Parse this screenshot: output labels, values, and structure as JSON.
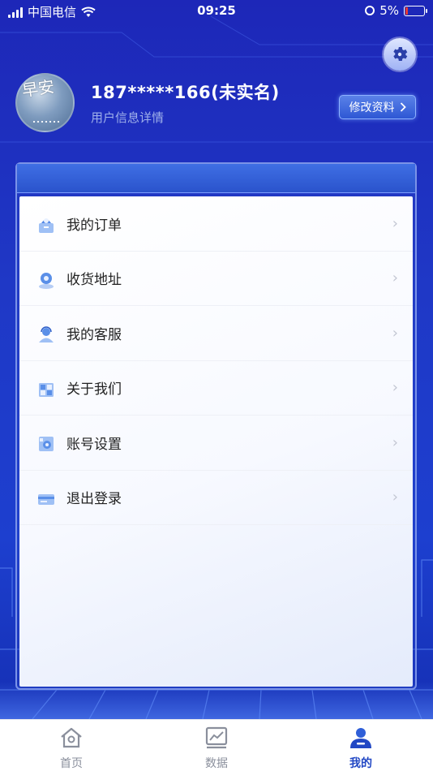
{
  "status_bar": {
    "carrier": "中国电信",
    "time": "09:25",
    "battery": "5%"
  },
  "profile": {
    "avatar_text": "早安",
    "user_name": "187*****166(未实名)",
    "subtitle": "用户信息详情",
    "edit_label": "修改资料"
  },
  "menu": {
    "items": [
      {
        "label": "我的订单",
        "icon": "order-bag-icon"
      },
      {
        "label": "收货地址",
        "icon": "location-pin-icon"
      },
      {
        "label": "我的客服",
        "icon": "customer-service-icon"
      },
      {
        "label": "关于我们",
        "icon": "building-icon"
      },
      {
        "label": "账号设置",
        "icon": "gear-box-icon"
      },
      {
        "label": "退出登录",
        "icon": "logout-card-icon"
      }
    ]
  },
  "tab_bar": {
    "tabs": [
      {
        "label": "首页",
        "icon": "home-icon"
      },
      {
        "label": "数据",
        "icon": "chart-icon"
      },
      {
        "label": "我的",
        "icon": "person-icon",
        "active": true
      }
    ]
  },
  "colors": {
    "background": "#1d2fc0",
    "accent": "#2147c4",
    "card": "#ffffff"
  }
}
